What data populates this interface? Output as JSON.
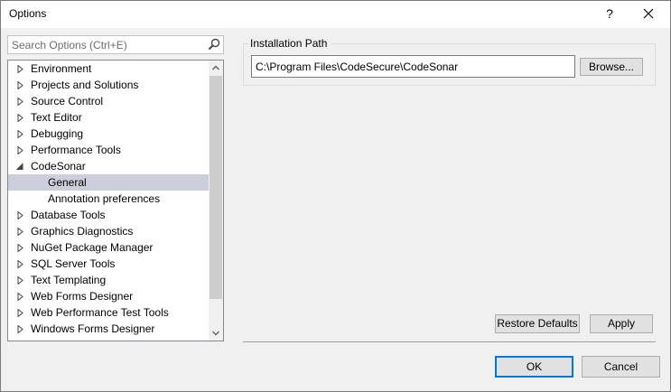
{
  "window": {
    "title": "Options",
    "help_label": "?"
  },
  "search": {
    "placeholder": "Search Options (Ctrl+E)"
  },
  "tree": {
    "items": [
      {
        "label": "Environment",
        "expanded": false
      },
      {
        "label": "Projects and Solutions",
        "expanded": false
      },
      {
        "label": "Source Control",
        "expanded": false
      },
      {
        "label": "Text Editor",
        "expanded": false
      },
      {
        "label": "Debugging",
        "expanded": false
      },
      {
        "label": "Performance Tools",
        "expanded": false
      },
      {
        "label": "CodeSonar",
        "expanded": true
      },
      {
        "label": "General",
        "selected": true
      },
      {
        "label": "Annotation preferences"
      },
      {
        "label": "Database Tools",
        "expanded": false
      },
      {
        "label": "Graphics Diagnostics",
        "expanded": false
      },
      {
        "label": "NuGet Package Manager",
        "expanded": false
      },
      {
        "label": "SQL Server Tools",
        "expanded": false
      },
      {
        "label": "Text Templating",
        "expanded": false
      },
      {
        "label": "Web Forms Designer",
        "expanded": false
      },
      {
        "label": "Web Performance Test Tools",
        "expanded": false
      },
      {
        "label": "Windows Forms Designer",
        "expanded": false
      }
    ]
  },
  "settings": {
    "group_label": "Installation Path",
    "installation_path": "C:\\Program Files\\CodeSecure\\CodeSonar",
    "browse_label": "Browse..."
  },
  "buttons": {
    "restore_defaults": "Restore Defaults",
    "apply": "Apply",
    "ok": "OK",
    "cancel": "Cancel"
  },
  "colors": {
    "selection": "#cccedb",
    "ok_border": "#0078d7"
  }
}
